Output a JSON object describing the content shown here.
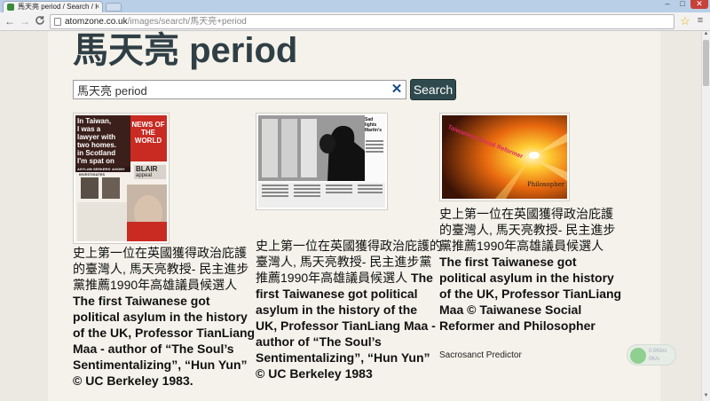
{
  "browser": {
    "tab_title": "馬天亮 period / Search / I",
    "tab_close": "×",
    "url_host": "atomzone.co.uk",
    "url_path": "/images/search/馬天亮+period",
    "back": "←",
    "forward": "→",
    "reload": "C",
    "star": "☆",
    "menu": "≡",
    "win_min": "–",
    "win_max": "□",
    "win_close": "✕"
  },
  "page": {
    "title": "馬天亮 period",
    "search": {
      "value": "馬天亮 period",
      "clear_glyph": "✕",
      "button_label": "Search"
    },
    "results": [
      {
        "caption_cjk": "史上第一位在英國獲得政治庇護的臺灣人, 馬天亮教授- 民主進步黨推薦1990年高雄議員候選人",
        "caption_en": " The first Taiwanese got political asylum in the history of the UK, Professor TianLiang Maa - author of “The Soul’s Sentimentalizing”, “Hun Yun” © UC Berkeley 1983."
      },
      {
        "caption_cjk": "史上第一位在英國獲得政治庇護的臺灣人, 馬天亮教授- 民主進步黨推薦1990年高雄議員候選人",
        "caption_en": " The first Taiwanese got political asylum in the history of the UK, Professor TianLiang Maa - author of “The Soul’s Sentimentalizing”, “Hun Yun” © UC Berkeley 1983"
      },
      {
        "caption_cjk": "史上第一位在英國獲得政治庇護的臺灣人, 馬天亮教授- 民主進步黨推薦1990年高雄議員候選人",
        "caption_en": " The first Taiwanese got political asylum in the history of the UK, Professor TianLiang Maa © Taiwanese Social Reformer and Philosopher",
        "sub_caption": "Sacrosanct Predictor"
      }
    ],
    "thumb1": {
      "headline_lines": [
        "In Taiwan,",
        "I was a",
        "lawyer with",
        "two homes.",
        "in Scotland",
        "I'm spat on"
      ],
      "masthead": "NEWS OF THE WORLD",
      "banner": "ASYLUM SEEKERS' AGONY",
      "investigates": "INVESTIGATES",
      "blair": "BLAIR",
      "appeal": "appeal"
    },
    "thumb2": {
      "headline": "Sad lights Martin's"
    },
    "thumb3": {
      "top_text": "Taiwanese Social Reformer",
      "bottom_text": "Philosopher"
    },
    "net_widget": {
      "up": "0.0Kb/s",
      "down": "0K/s"
    }
  }
}
